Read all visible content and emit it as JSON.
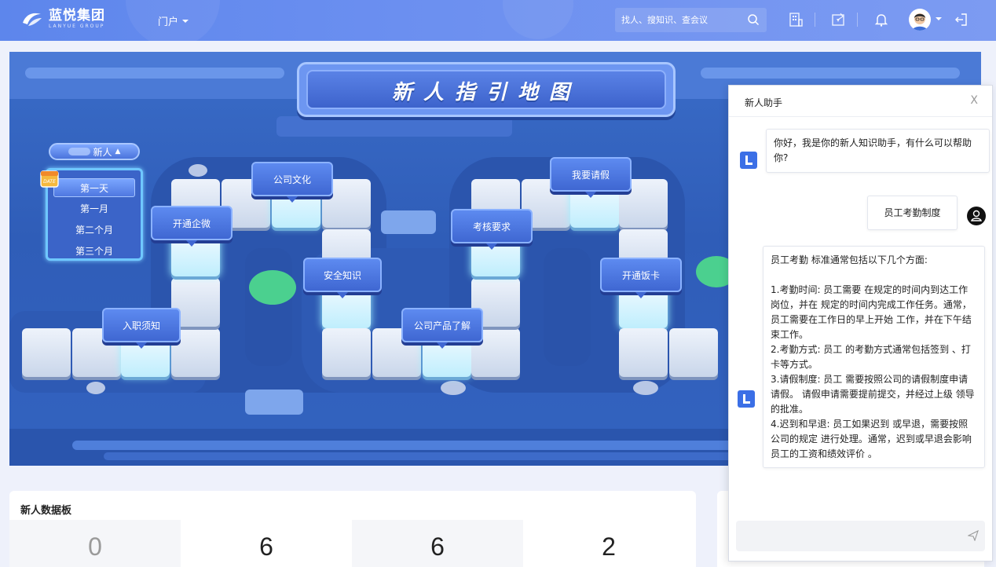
{
  "header": {
    "brand_name": "蓝悦集团",
    "brand_sub": "LANYUE GROUP",
    "nav_menu_label": "门户",
    "search_placeholder": "找人、搜知识、查会议",
    "brand_color": "#6b8ff0"
  },
  "map": {
    "title": "新人指引地图",
    "level_selector_label": "新人",
    "periods": [
      "第一天",
      "第一月",
      "第二个月",
      "第三个月"
    ],
    "active_period": "第一天",
    "calendar_icon_text": "DATE",
    "tasks": [
      "入职须知",
      "开通企微",
      "公司文化",
      "安全知识",
      "公司产品了解",
      "考核要求",
      "我要请假",
      "开通饭卡"
    ]
  },
  "assistant": {
    "title": "新人助手",
    "close_label": "X",
    "messages": [
      {
        "from": "bot",
        "text": "你好，我是你的新人知识助手，有什么可以帮助你?"
      },
      {
        "from": "user",
        "text": "员工考勤制度"
      },
      {
        "from": "bot",
        "text": "员工考勤 标准通常包括以下几个方面:\n\n1.考勤时间: 员工需要 在规定的时间内到达工作岗位，并在 规定的时间内完成工作任务。通常， 员工需要在工作日的早上开始 工作，并在下午结束工作。\n2.考勤方式: 员工 的考勤方式通常包括签到 、打卡等方式。\n3.请假制度: 员工 需要按照公司的请假制度申请请假。 请假申请需要提前提交，并经过上级 领导的批准。\n4.迟到和早退: 员工如果迟到 或早退，需要按照公司的规定 进行处理。通常，迟到或早退会影响员工的工资和绩效评价 。"
      }
    ],
    "input_placeholder": ""
  },
  "board": {
    "title": "新人数据板",
    "stats": [
      "0",
      "6",
      "6",
      "2"
    ]
  }
}
